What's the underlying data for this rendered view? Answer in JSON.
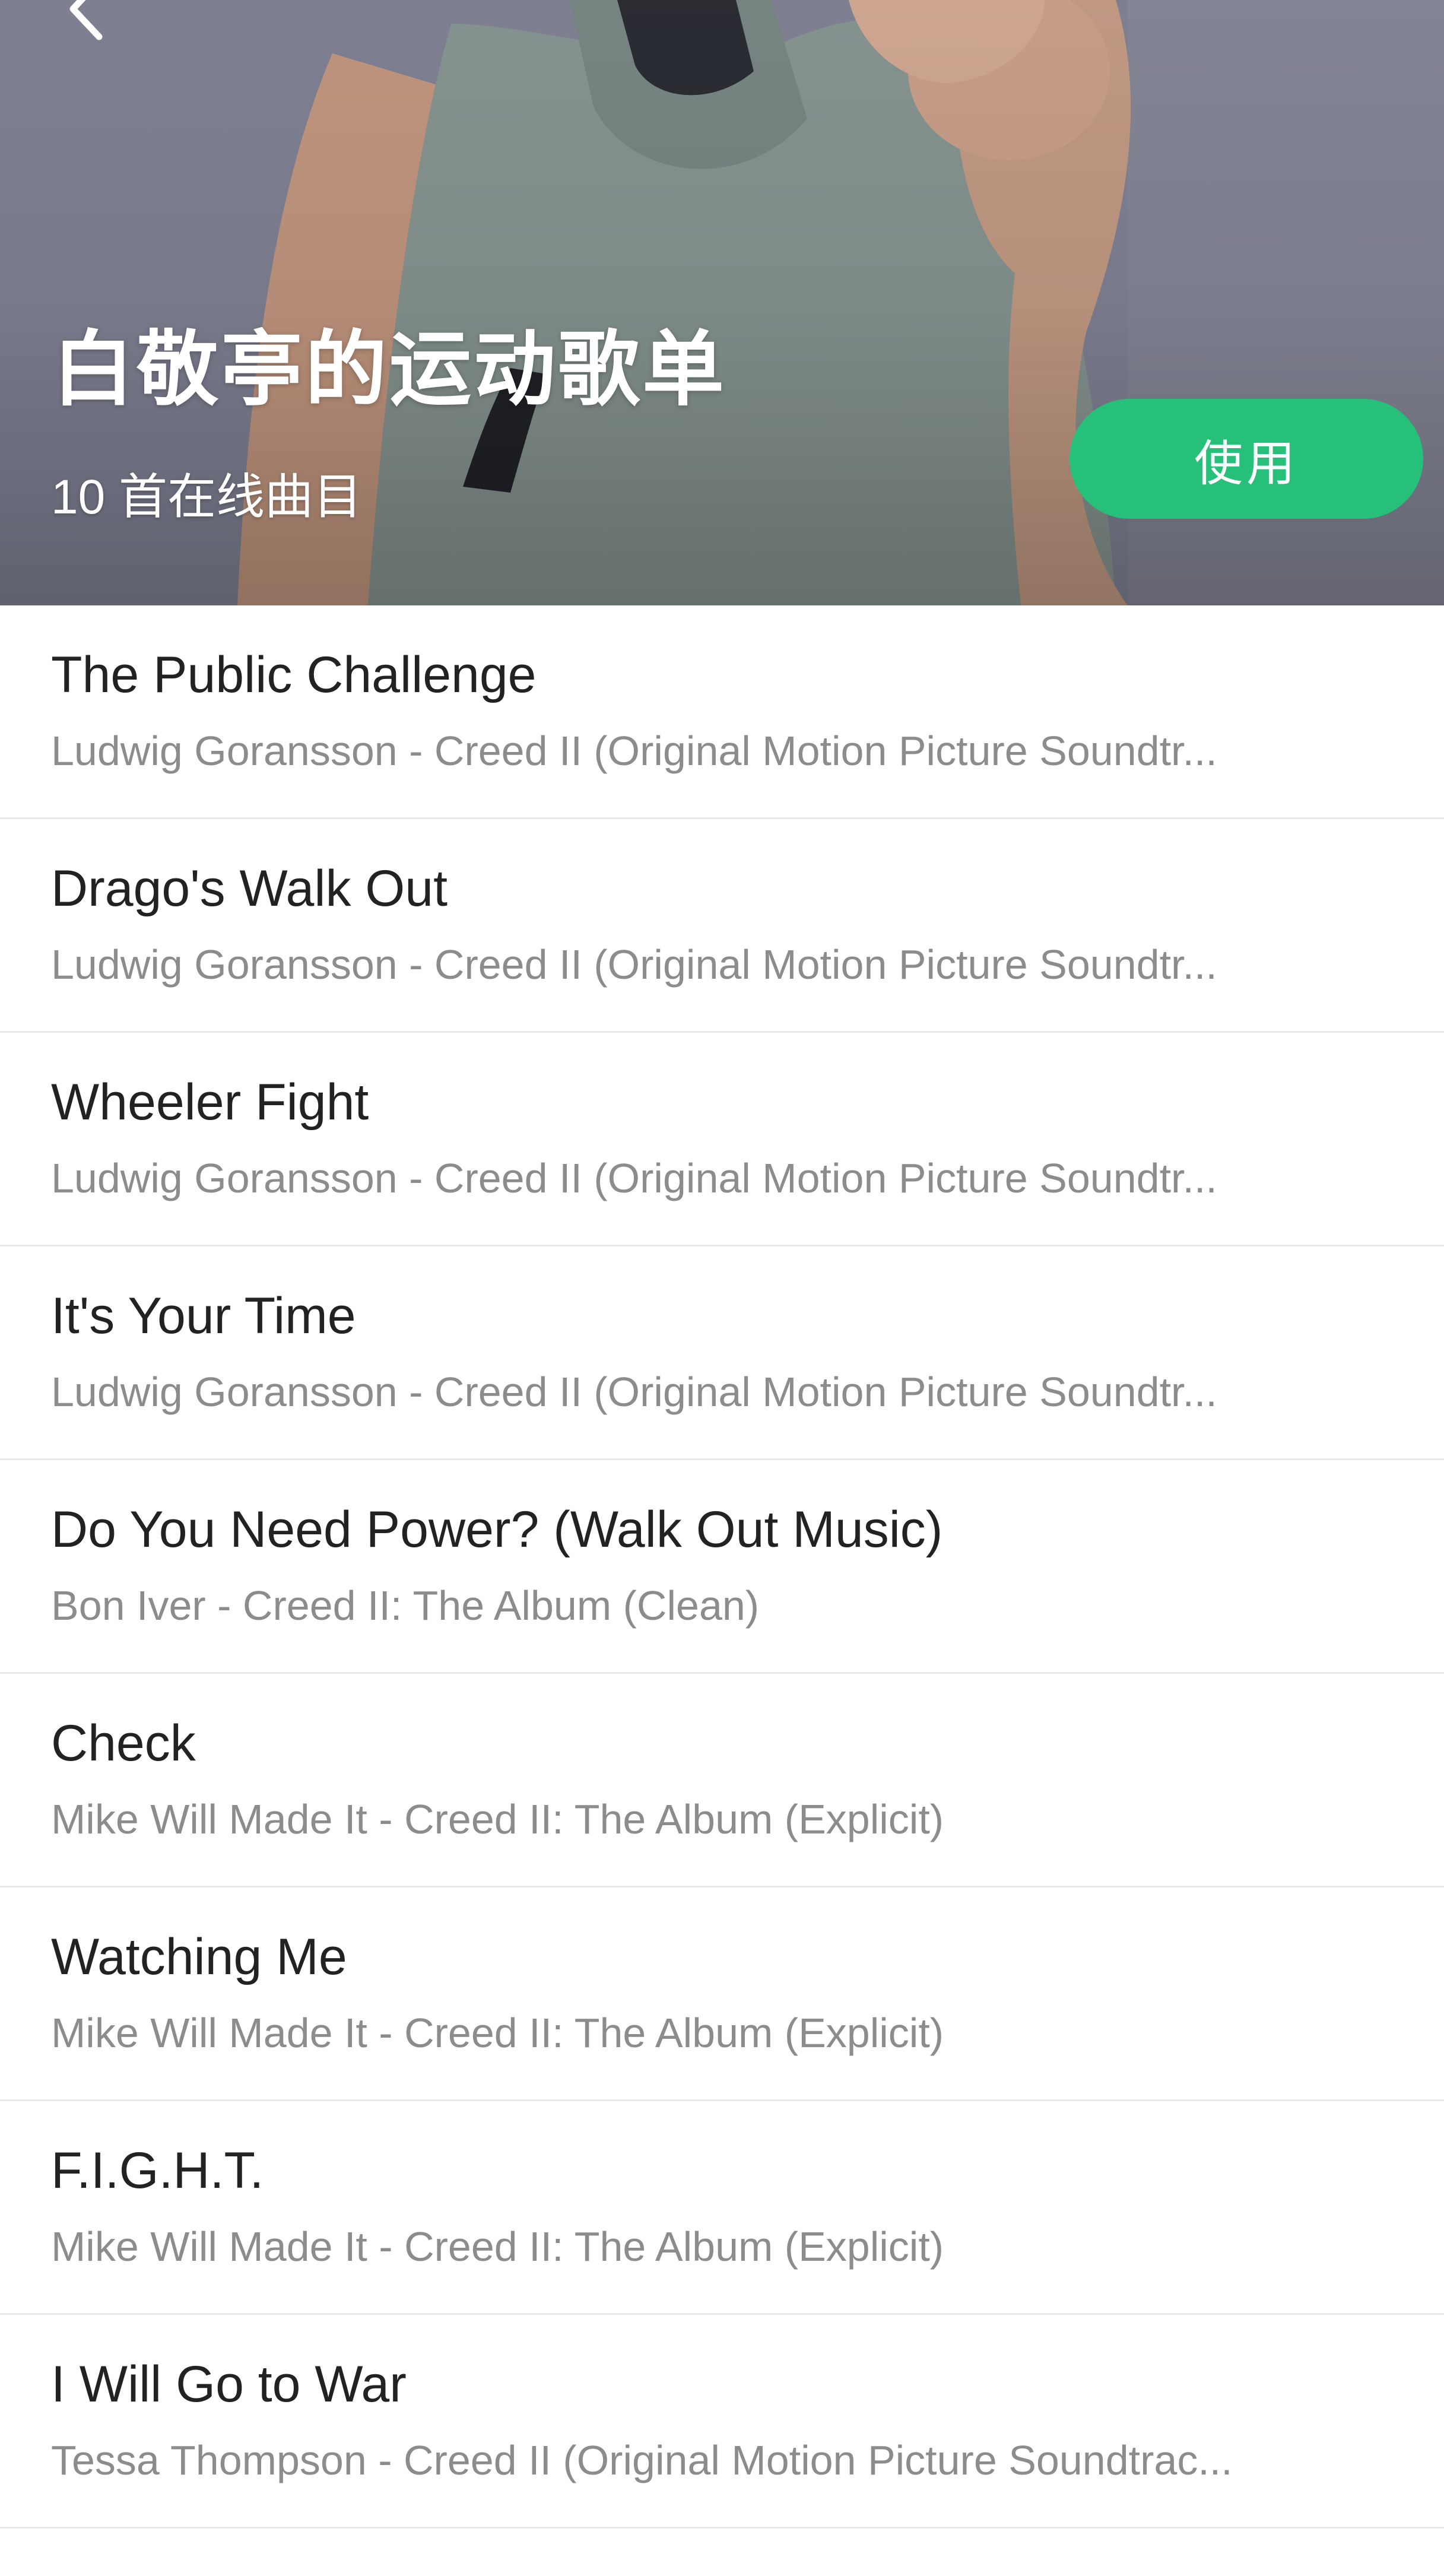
{
  "header": {
    "back_icon": "chevron-left-icon",
    "title": "白敬亭的运动歌单",
    "track_count": "10 首在线曲目",
    "use_button_label": "使用",
    "accent_color": "#27c07a"
  },
  "tracks": [
    {
      "title": "The Public Challenge",
      "subtitle": "Ludwig Goransson - Creed II (Original Motion Picture Soundtr..."
    },
    {
      "title": "Drago's Walk Out",
      "subtitle": "Ludwig Goransson - Creed II (Original Motion Picture Soundtr..."
    },
    {
      "title": "Wheeler Fight",
      "subtitle": "Ludwig Goransson - Creed II (Original Motion Picture Soundtr..."
    },
    {
      "title": "It's Your Time",
      "subtitle": "Ludwig Goransson - Creed II (Original Motion Picture Soundtr..."
    },
    {
      "title": "Do You Need Power? (Walk Out Music)",
      "subtitle": "Bon Iver - Creed II: The Album (Clean)"
    },
    {
      "title": "Check",
      "subtitle": "Mike Will Made It - Creed II: The Album (Explicit)"
    },
    {
      "title": "Watching Me",
      "subtitle": "Mike Will Made It - Creed II: The Album (Explicit)"
    },
    {
      "title": "F.I.G.H.T.",
      "subtitle": "Mike Will Made It - Creed II: The Album (Explicit)"
    },
    {
      "title": "I Will Go to War",
      "subtitle": "Tessa Thompson - Creed II (Original Motion Picture Soundtrac..."
    }
  ]
}
